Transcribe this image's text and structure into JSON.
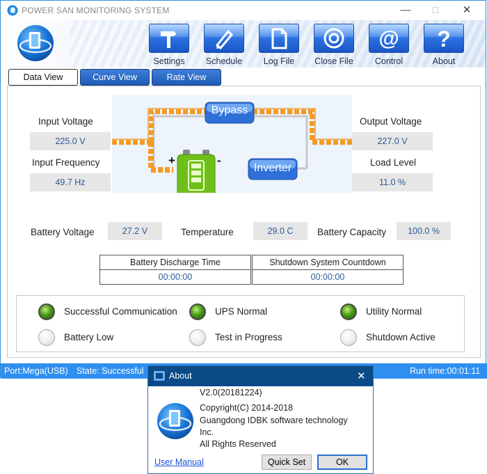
{
  "window": {
    "title": "POWER SAN MONITORING SYSTEM",
    "minimize": "—",
    "maximize": "☐",
    "close": "✕"
  },
  "toolbar": {
    "items": [
      {
        "label": "Settings",
        "icon": "settings-tools-icon"
      },
      {
        "label": "Schedule",
        "icon": "schedule-icon"
      },
      {
        "label": "Log File",
        "icon": "log-file-icon"
      },
      {
        "label": "Close File",
        "icon": "close-file-icon"
      },
      {
        "label": "Control",
        "icon": "control-at-icon"
      },
      {
        "label": "About",
        "icon": "about-question-icon"
      }
    ]
  },
  "tabs": [
    {
      "label": "Data View",
      "active": true
    },
    {
      "label": "Curve View",
      "active": false
    },
    {
      "label": "Rate View",
      "active": false
    }
  ],
  "readings": {
    "input_voltage": {
      "label": "Input Voltage",
      "value": "225.0 V"
    },
    "input_frequency": {
      "label": "Input Frequency",
      "value": "49.7 Hz"
    },
    "output_voltage": {
      "label": "Output Voltage",
      "value": "227.0 V"
    },
    "load_level": {
      "label": "Load Level",
      "value": "11.0 %"
    },
    "battery_voltage": {
      "label": "Battery Voltage",
      "value": "27.2 V"
    },
    "temperature": {
      "label": "Temperature",
      "value": "29.0 C"
    },
    "battery_capacity": {
      "label": "Battery Capacity",
      "value": "100.0 %"
    }
  },
  "diagram": {
    "bypass": "Bypass",
    "inverter": "Inverter",
    "plus": "+",
    "minus": "-",
    "line_color": "#f59a23",
    "button_color": "#3a86e8"
  },
  "timers": {
    "discharge_label": "Battery Discharge Time",
    "discharge_value": "00:00:00",
    "shutdown_label": "Shutdown System Countdown",
    "shutdown_value": "00:00:00"
  },
  "indicators": [
    {
      "label": "Successful Communication",
      "on": true
    },
    {
      "label": "UPS Normal",
      "on": true
    },
    {
      "label": "Utility Normal",
      "on": true
    },
    {
      "label": "Battery Low",
      "on": false
    },
    {
      "label": "Test in Progress",
      "on": false
    },
    {
      "label": "Shutdown Active",
      "on": false
    }
  ],
  "status": {
    "port": "Port:Mega(USB)",
    "state": "State: Successful",
    "runtime": "Run time:00:01:11"
  },
  "about": {
    "title": "About",
    "version": "V2.0(20181224)",
    "copyright": "Copyright(C) 2014-2018",
    "company_line1": "Guangdong IDBK software technology",
    "company_line2": "Inc.",
    "rights": "All Rights Reserved",
    "user_manual": "User Manual",
    "quick_set": "Quick Set",
    "ok": "OK",
    "close": "✕"
  },
  "colors": {
    "accent": "#2f8ff0",
    "dialog_title": "#0a4a86",
    "value_text": "#2a5a96"
  }
}
